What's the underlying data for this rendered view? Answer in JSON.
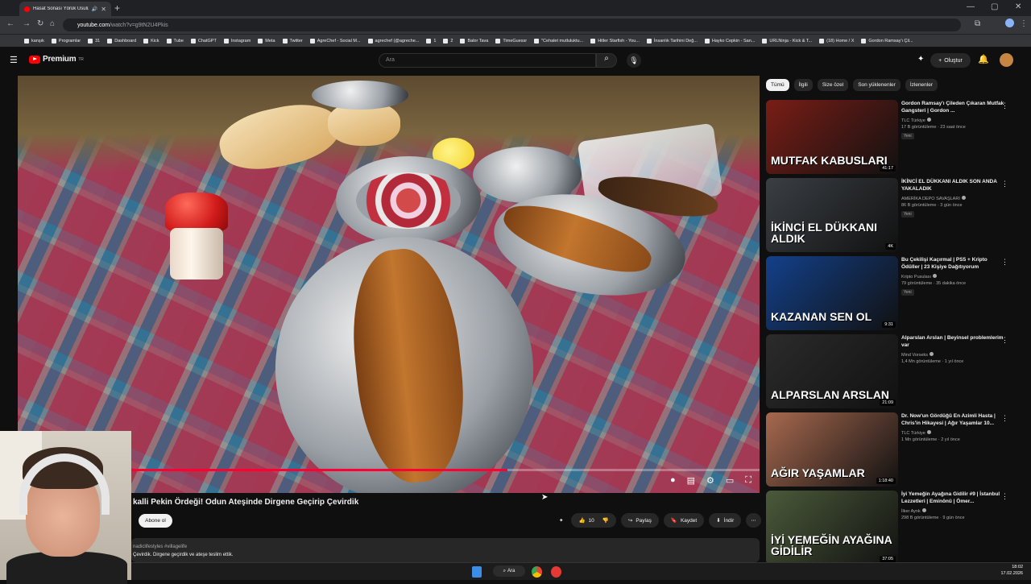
{
  "browser": {
    "tab_title": "Hasat Sonası Yörük Usulü P...",
    "url_host": "youtube.com",
    "url_path": "/watch?v=g9tN2U4Pkis",
    "bookmarks": [
      "kanşık",
      "Programlar",
      "31",
      "Dashboard",
      "Kick",
      "Tube",
      "ChatGPT",
      "Instagram",
      "Meta",
      "Twitter",
      "AgreChef - Social M...",
      "agrechef (@agreche...",
      "1",
      "2",
      "Balor Tava",
      "TimeGuessr",
      "\"Cehalet mutluluktu...",
      "Hitler Starfish - You...",
      "İnsanlık Tarihini Değ...",
      "Hayko Cepkin - San...",
      "URLNinja - Kick & T...",
      "(18) Home / X",
      "Gordon Ramsay'ı Çil..."
    ]
  },
  "header": {
    "logo_text": "Premium",
    "logo_sup": "TR",
    "search_placeholder": "Ara",
    "create_label": "Oluştur"
  },
  "video": {
    "title": "kalli Pekin Ördeği! Odun Ateşinde Dirgene Geçirip Çevirdik",
    "subscribe_label": "Abone ol",
    "progress": 0.66,
    "like_count": "10",
    "share_label": "Paylaş",
    "save_label": "Kaydet",
    "download_label": "İndir",
    "desc_tags": "nadiclifestyles #villagelife",
    "desc_text": "Çevirdik.  Dirgene geçirdik ve ateşe teslim ettik."
  },
  "sidebar": {
    "chips": [
      "Tümü",
      "İlgili",
      "Size özel",
      "Son yüklenenler",
      "İzlenenler"
    ],
    "items": [
      {
        "title": "Gordon Ramsay'ı Çileden Çıkaran Mutfak Gangsteri | Gordon ...",
        "channel": "TLC Türkiye",
        "meta": "17 B görüntüleme · 23 saat önce",
        "badge": "Yeni",
        "duration": "41:17",
        "thumb_text": "MUTFAK KABUSLARI",
        "thumb_color": "#7a1d16"
      },
      {
        "title": "İKİNCİ EL DÜKKANI ALDIK SON ANDA YAKALADIK",
        "channel": "AMERİKA DEPO SAVAŞLARI",
        "meta": "86 B görüntüleme · 3 gün önce",
        "badge": "Yeni",
        "duration": "4K",
        "thumb_text": "İKİNCİ EL DÜKKANI ALDIK",
        "thumb_color": "#3a3f44"
      },
      {
        "title": "Bu Çekilişi Kaçırmal | PS5 + Kripto Ödüller | 23 Kişiye Dağıtıyorum",
        "channel": "Kripto Pusulası",
        "meta": "79 görüntüleme · 35 dakika önce",
        "badge": "Yeni",
        "duration": "9:31",
        "thumb_text": "KAZANAN SEN OL",
        "thumb_color": "#13408a"
      },
      {
        "title": "Alparslan Arslan | Beyinsel problemlerim var",
        "channel": "Mind Vorseks",
        "meta": "1,4 Mn görüntüleme · 1 yıl önce",
        "badge": "",
        "duration": "21:09",
        "thumb_text": "ALPARSLAN ARSLAN",
        "thumb_color": "#2b2b2b"
      },
      {
        "title": "Dr. Now'un Gördüğü En Azimli Hasta | Chris'in Hikayesi | Ağır Yaşamlar 10...",
        "channel": "TLC Türkiye",
        "meta": "1 Mn görüntüleme · 2 yıl önce",
        "badge": "",
        "duration": "1:18:40",
        "thumb_text": "AĞIR YAŞAMLAR",
        "thumb_color": "#a7694f"
      },
      {
        "title": "İyi Yemeğin Ayağına Gidilir #9 | İstanbul Lezzetleri | Eminönü | Ömer...",
        "channel": "İlker Aynk",
        "meta": "298 B görüntüleme · 9 gün önce",
        "badge": "",
        "duration": "37:05",
        "thumb_text": "İYİ YEMEĞİN AYAĞINA GİDİLİR",
        "thumb_color": "#4b5a3a"
      }
    ]
  },
  "taskbar": {
    "search_label": "Ara",
    "time": "18:02",
    "date": "17.02.2026"
  },
  "colors": {
    "accent": "#ff0033",
    "bg": "#0f0f0f"
  }
}
